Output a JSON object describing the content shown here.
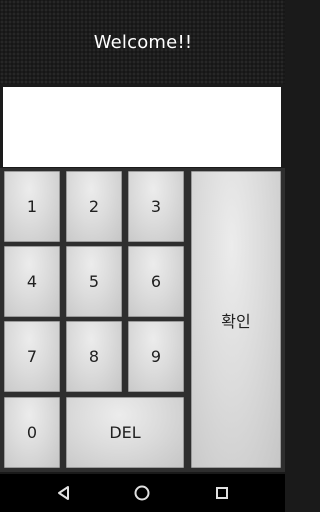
{
  "header": {
    "title": "Welcome!!"
  },
  "pin_display": {
    "value": ""
  },
  "keypad": {
    "key_1": "1",
    "key_2": "2",
    "key_3": "3",
    "key_4": "4",
    "key_5": "5",
    "key_6": "6",
    "key_7": "7",
    "key_8": "8",
    "key_9": "9",
    "key_0": "0",
    "delete": "DEL",
    "confirm": "확인"
  },
  "navigation_bar": {
    "icons": [
      "back-icon",
      "home-icon",
      "recents-icon"
    ],
    "icon_color": "#e0e0e0"
  },
  "colors": {
    "header_background": "#1c1c1c",
    "keypad_background": "#2e2e2e",
    "key_face": "#dcdcdc",
    "display_background": "#ffffff"
  }
}
